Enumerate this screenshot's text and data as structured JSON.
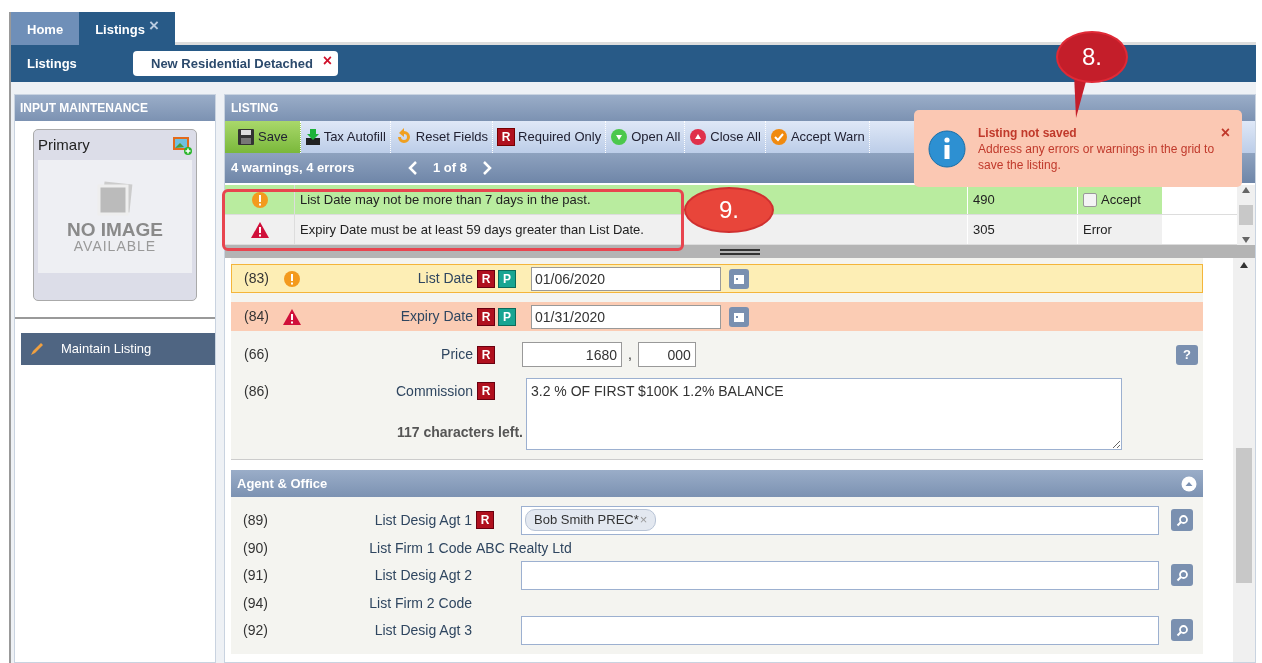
{
  "tabs": [
    {
      "label": "Home",
      "selected": false
    },
    {
      "label": "Listings",
      "selected": true,
      "close": "×"
    }
  ],
  "header": {
    "title": "Listings",
    "open_forms": [
      {
        "label": "New Residential Detached",
        "close": "×"
      }
    ]
  },
  "sidebar": {
    "title": "INPUT MAINTENANCE",
    "photo_card": {
      "title": "Primary",
      "placeholder_text": [
        "NO IMAGE",
        "AVAILABLE"
      ]
    },
    "actions": [
      {
        "label": "Maintain Listing"
      }
    ]
  },
  "listing": {
    "title": "LISTING",
    "toolbar": [
      {
        "label": "Save",
        "kind": "save",
        "active": true
      },
      {
        "label": "Tax Autofill",
        "kind": "autofill",
        "active": false
      },
      {
        "label": "Reset Fields",
        "kind": "reset",
        "active": false
      },
      {
        "label": "Required Only",
        "kind": "required",
        "icon_text": "R",
        "active": false
      },
      {
        "label": "Open All",
        "kind": "open",
        "active": false
      },
      {
        "label": "Close All",
        "kind": "close",
        "active": false
      },
      {
        "label": "Accept Warn",
        "kind": "accept",
        "active": false
      }
    ],
    "summary": "4 warnings, 4 errors",
    "pager": "1 of 8",
    "messages": [
      {
        "kind": "warning",
        "message": "List Date may not be more than 7 days in the past.",
        "code": "490",
        "action": {
          "kind": "checkbox",
          "label": "Accept",
          "checked": false
        },
        "selected": true
      },
      {
        "kind": "error",
        "message": "Expiry Date must be at least 59 days greater than List Date.",
        "code": "305",
        "action": {
          "kind": "text",
          "label": "Error"
        },
        "selected": false
      }
    ],
    "fields": [
      {
        "kind": "date",
        "number": "(83)",
        "warning": true,
        "label": "List Date",
        "badges": [
          {
            "text": "R",
            "kind": "required"
          },
          {
            "text": "P",
            "kind": "public"
          }
        ],
        "value": "01/06/2020"
      },
      {
        "kind": "date",
        "number": "(84)",
        "error": true,
        "label": "Expiry Date",
        "badges": [
          {
            "text": "R",
            "kind": "required"
          },
          {
            "text": "P",
            "kind": "public"
          }
        ],
        "value": "01/31/2020"
      },
      {
        "kind": "price",
        "number": "(66)",
        "label": "Price",
        "badges": [
          {
            "text": "R",
            "kind": "required"
          }
        ],
        "value": "1680",
        "separator": ",",
        "value2": "000",
        "help": "?"
      },
      {
        "kind": "textarea",
        "number": "(86)",
        "label": "Commission",
        "badges": [
          {
            "text": "R",
            "kind": "required"
          }
        ],
        "value": "3.2 % OF FIRST $100K 1.2% BALANCE",
        "counter": "117 characters left."
      }
    ],
    "sections": [
      {
        "title": "Agent & Office",
        "expanded": true,
        "fields": [
          {
            "kind": "lookup",
            "number": "(89)",
            "label": "List Desig Agt 1",
            "badges": [
              {
                "text": "R",
                "kind": "required"
              }
            ],
            "tokens": [
              {
                "label": "Bob Smith PREC*",
                "remove": "×"
              }
            ]
          },
          {
            "kind": "text",
            "number": "(90)",
            "label": "List Firm 1 Code",
            "value": "ABC Realty Ltd"
          },
          {
            "kind": "lookup",
            "number": "(91)",
            "label": "List Desig Agt 2"
          },
          {
            "kind": "text",
            "number": "(94)",
            "label": "List Firm 2 Code"
          },
          {
            "kind": "lookup",
            "number": "(92)",
            "label": "List Desig Agt 3"
          }
        ]
      }
    ]
  },
  "toast": {
    "title": "Listing not saved",
    "message": "Address any errors or warnings in the grid to save the listing.",
    "close": "×"
  },
  "callouts": [
    {
      "label": "8."
    },
    {
      "label": "9."
    }
  ]
}
